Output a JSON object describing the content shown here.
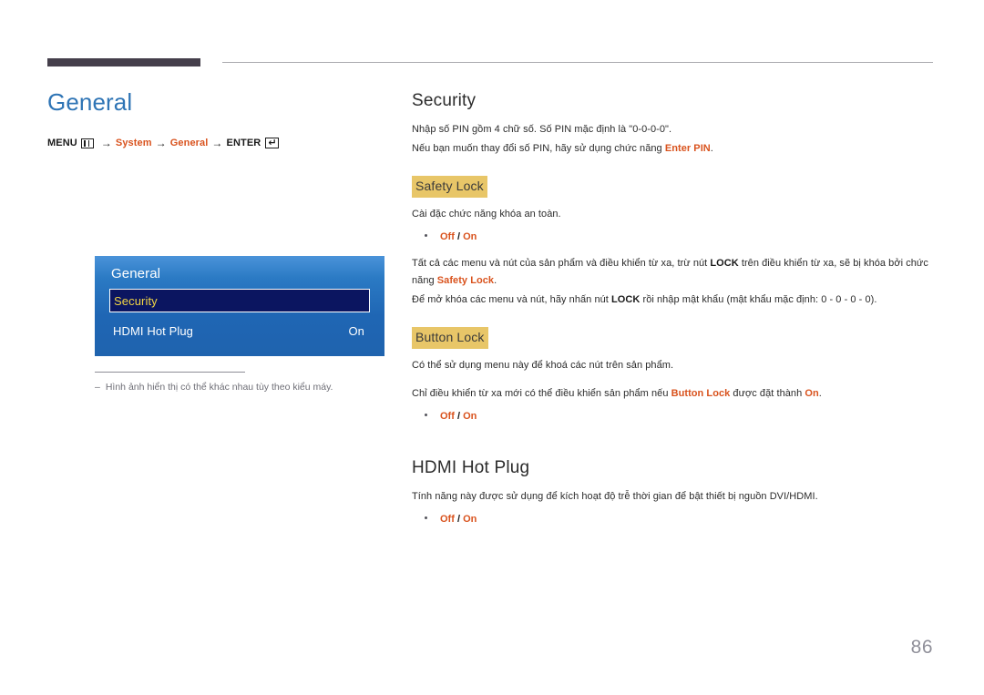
{
  "header": {
    "rule_color": "#453f4b"
  },
  "left": {
    "page_title": "General",
    "breadcrumb": {
      "menu_label": "MENU",
      "menu_icon": "menu-bars-icon",
      "arrow": "→",
      "item1": "System",
      "item2": "General",
      "enter_label": "ENTER",
      "enter_icon": "enter-return-icon"
    },
    "osd": {
      "title": "General",
      "rows": [
        {
          "label": "Security",
          "value": "",
          "selected": true
        },
        {
          "label": "HDMI Hot Plug",
          "value": "On",
          "selected": false
        }
      ]
    },
    "footnote": {
      "dash": "‒",
      "text": "Hình ảnh hiển thị có thể khác nhau tùy theo kiểu máy."
    }
  },
  "right": {
    "security": {
      "heading": "Security",
      "line1": "Nhập số PIN gồm 4 chữ số. Số PIN mặc định là \"0-0-0-0\".",
      "line2_pre": "Nếu bạn muốn thay đổi số PIN, hãy sử dụng chức năng ",
      "line2_accent": "Enter PIN",
      "line2_post": "."
    },
    "safety_lock": {
      "heading": "Safety Lock",
      "desc": "Cài đặc chức năng khóa an toàn.",
      "options": {
        "off": "Off",
        "sep": " / ",
        "on": "On"
      },
      "para1_a": "Tất cả các menu và nút của sản phẩm và điều khiển từ xa, trừ nút ",
      "para1_b": "LOCK",
      "para1_c": " trên điều khiển từ xa, sẽ bị khóa bởi chức năng ",
      "para1_d": "Safety Lock",
      "para1_e": ".",
      "para2_a": "Để mở khóa các menu và nút, hãy nhấn nút ",
      "para2_b": "LOCK",
      "para2_c": " rồi nhập mật khẩu (mật khẩu mặc định: 0 - 0 - 0 - 0)."
    },
    "button_lock": {
      "heading": "Button Lock",
      "desc": "Có thể sử dụng menu này để khoá các nút trên sản phẩm.",
      "para_a": "Chỉ điều khiển từ xa mới có thể điều khiển sản phẩm nếu ",
      "para_b": "Button Lock",
      "para_c": " được đặt thành ",
      "para_d": "On",
      "para_e": ".",
      "options": {
        "off": "Off",
        "sep": " / ",
        "on": "On"
      }
    },
    "hdmi_hot_plug": {
      "heading": "HDMI Hot Plug",
      "desc": "Tính năng này được sử dụng để kích hoạt độ trễ thời gian để bật thiết bị nguồn DVI/HDMI.",
      "options": {
        "off": "Off",
        "sep": " / ",
        "on": "On"
      }
    }
  },
  "footer": {
    "page_number": "86"
  }
}
